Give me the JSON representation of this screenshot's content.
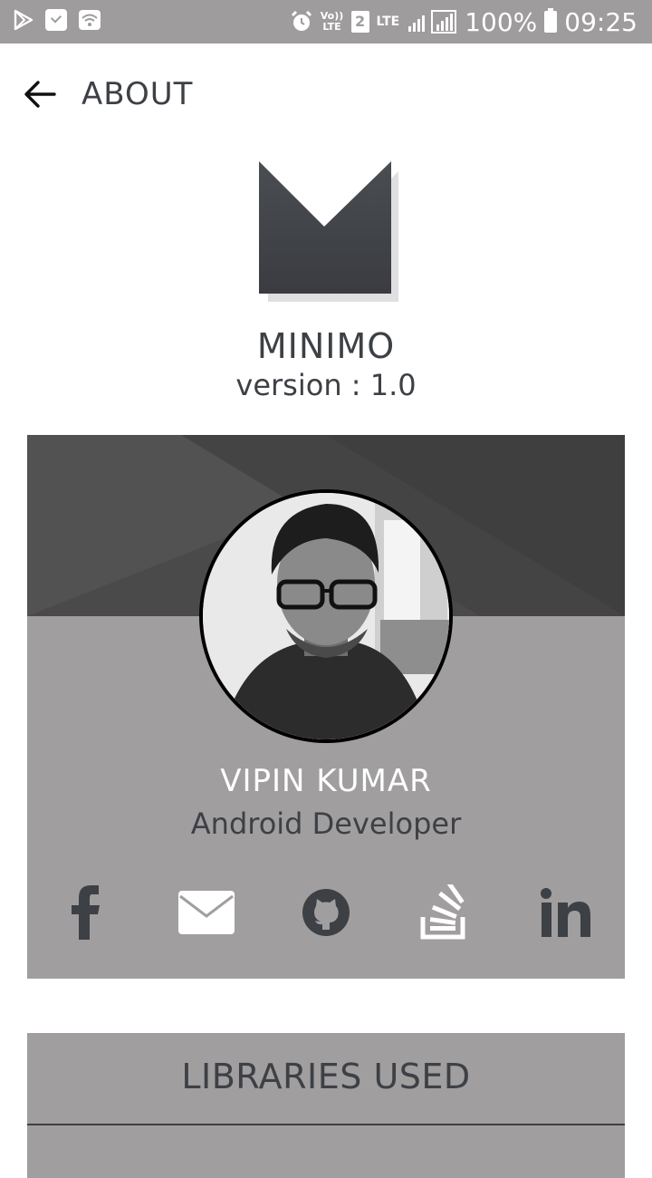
{
  "status_bar": {
    "battery": "100%",
    "time": "09:25",
    "volte": "Vo)) LTE",
    "sim": "2",
    "lte": "LTE",
    "roaming": "R"
  },
  "appbar": {
    "title": "ABOUT"
  },
  "app": {
    "name": "MINIMO",
    "version": "version : 1.0"
  },
  "developer": {
    "name": "VIPIN KUMAR",
    "role": "Android Developer",
    "social": [
      "facebook-icon",
      "email-icon",
      "github-icon",
      "stackoverflow-icon",
      "linkedin-icon"
    ]
  },
  "libraries": {
    "title": "LIBRARIES USED",
    "first_item": ""
  },
  "colors": {
    "status_bar": "#9e9c9d",
    "card": "#a09e9f",
    "card_header": "#4a4a4a",
    "text_dark": "#3d4045"
  }
}
